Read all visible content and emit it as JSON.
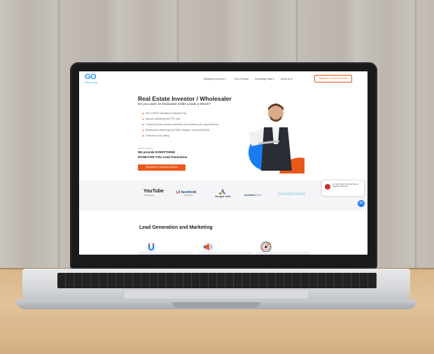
{
  "site": {
    "logo_text": "GO",
    "logo_sub": "FORECLOSE",
    "nav": {
      "items": [
        "Marketing Services ▾",
        "How It Works",
        "Knowledge Base ▾",
        "About Us ▾"
      ],
      "cta": "REQUEST A CONSULTATION"
    },
    "hero": {
      "title": "Real Estate Investor / Wholesaler",
      "subtitle": "Do you want 10 Motivated Seller Leads a Week?",
      "bullets": [
        "EXCLUSIVE motivated homeowner list",
        "Inbound marketing with PPC Ads",
        "Tracked Hit Area owners proactively and schedule your appointments",
        "Multichannel marketing with SMS, Ringless Voicemail (RVM),",
        "Email and Cold Calling"
      ],
      "small_label": "We are creators",
      "provide_line1": "We provide EVERYTHING",
      "provide_line2": "DONE-FOR-YOU Lead Generation",
      "cta": "REQUEST CONSULTATION"
    },
    "partners": {
      "youtube": "YouTube",
      "youtube_sub": "Advertising",
      "facebook": "facebook",
      "facebook_sub": "advertising",
      "google": "Google Ads",
      "investorfuse_a": "Investor",
      "investorfuse_b": "Fuse",
      "dialmachine": "DIALMACHINE"
    },
    "chat": {
      "message": "Hi, How Could I Improve Save a question? We here."
    },
    "section_title": "Lead Generation and Marketing"
  },
  "colors": {
    "accent": "#e8591a",
    "brand_blue": "#1d9bf0"
  }
}
